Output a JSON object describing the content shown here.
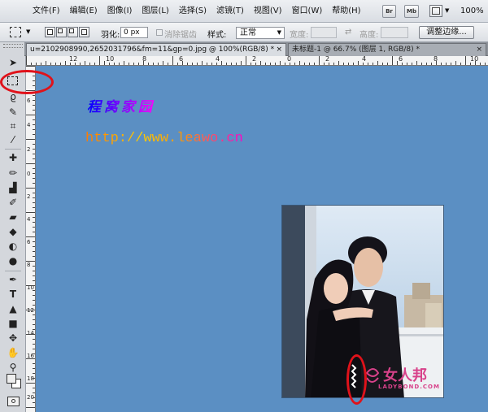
{
  "menubar": {
    "items": [
      "文件(F)",
      "编辑(E)",
      "图像(I)",
      "图层(L)",
      "选择(S)",
      "滤镜(T)",
      "视图(V)",
      "窗口(W)",
      "帮助(H)"
    ],
    "br_label": "Br",
    "mb_label": "Mb",
    "zoom": "100%"
  },
  "options": {
    "feather_label": "羽化:",
    "feather_value": "0 px",
    "antialias_label": "消除锯齿",
    "style_label": "样式:",
    "style_value": "正常",
    "width_label": "宽度:",
    "height_label": "高度:",
    "refine_edge_label": "调整边缘..."
  },
  "tabs": [
    {
      "label": "u=2102908990,2652031796&fm=11&gp=0.jpg @ 100%(RGB/8) *",
      "close": "×"
    },
    {
      "label": "未标题-1 @ 66.7% (图层 1, RGB/8) *",
      "close": "×"
    }
  ],
  "ruler_h_labels": [
    "12",
    "10",
    "8",
    "6",
    "4",
    "2",
    "0",
    "2",
    "4",
    "6",
    "8",
    "10"
  ],
  "ruler_v_labels": [
    "6",
    "4",
    "2",
    "0",
    "2",
    "4",
    "6",
    "8",
    "10",
    "12",
    "14",
    "16",
    "18",
    "20",
    "22"
  ],
  "canvas": {
    "brand_title": "程窝家园",
    "brand_url": "http://www.leawo.cn"
  },
  "watermark": {
    "text": "女人邦",
    "subtext": "LADYBOND.COM"
  },
  "colors": {
    "canvas_bg": "#5b8fc3",
    "annotation_red": "#e0121a",
    "watermark_pink": "#d8428a"
  }
}
